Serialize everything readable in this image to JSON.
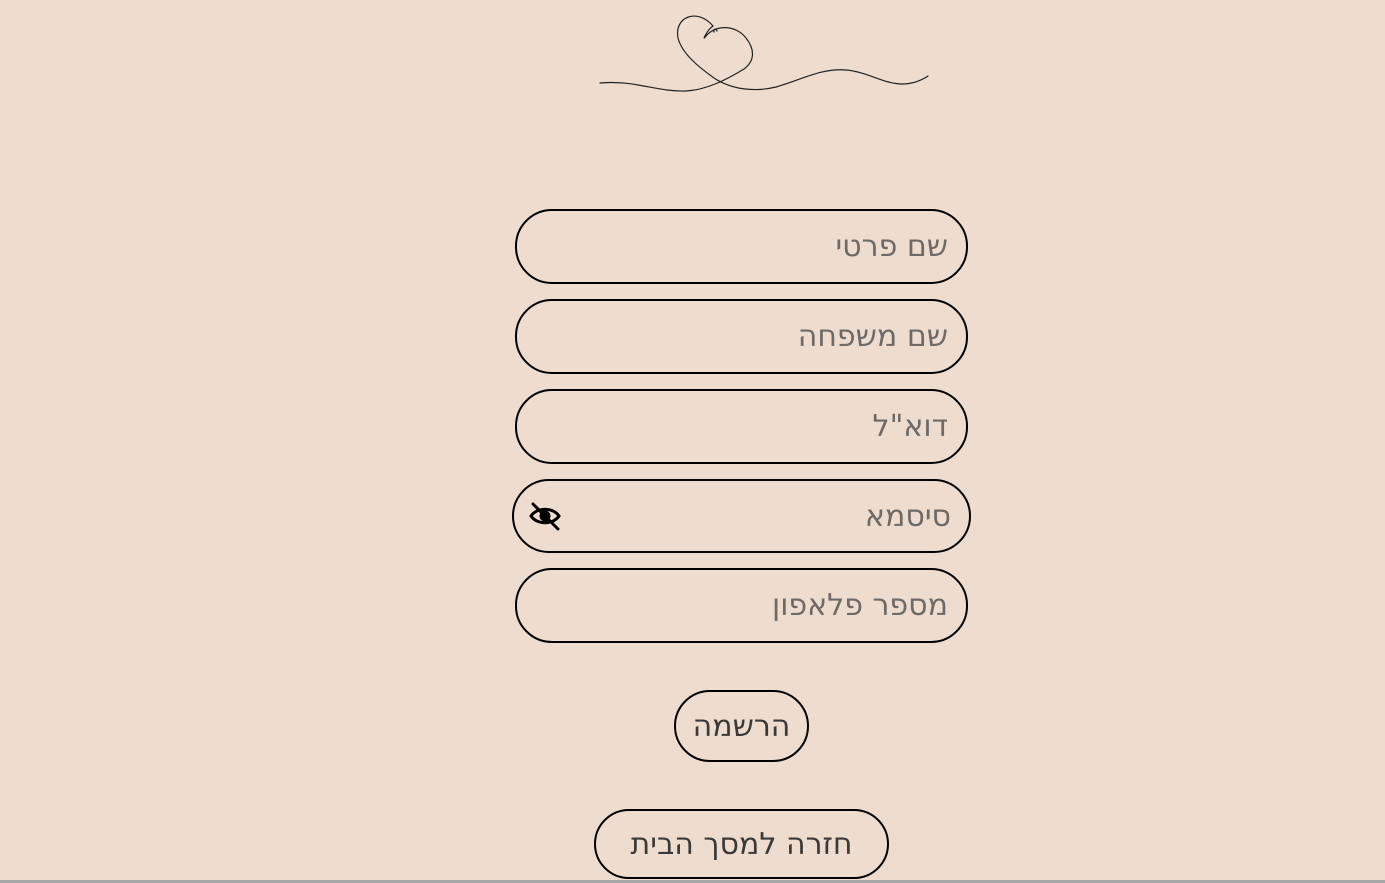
{
  "logo": {
    "icon": "heart-line-icon"
  },
  "form": {
    "first_name": {
      "placeholder": "שם פרטי",
      "value": ""
    },
    "last_name": {
      "placeholder": "שם משפחה",
      "value": ""
    },
    "email": {
      "placeholder": "דוא\"ל",
      "value": ""
    },
    "password": {
      "placeholder": "סיסמא",
      "value": "",
      "toggle_icon": "eye-off-icon"
    },
    "phone": {
      "placeholder": "מספר פלאפון",
      "value": ""
    }
  },
  "buttons": {
    "register_label": "הרשמה",
    "home_label": "חזרה למסך הבית"
  },
  "colors": {
    "background": "#eeddcf",
    "border": "#000000",
    "placeholder": "#6d6a67",
    "button_text": "#3a3a3a"
  }
}
